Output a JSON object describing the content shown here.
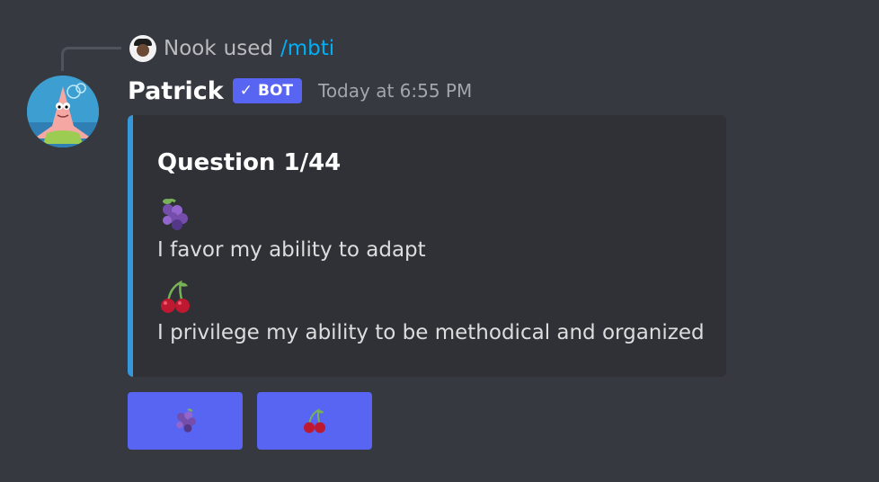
{
  "reply": {
    "user": "Nook",
    "used_text": "used",
    "command": "/mbti"
  },
  "message": {
    "username": "Patrick",
    "badge": "BOT",
    "timestamp": "Today at 6:55 PM"
  },
  "embed": {
    "accent_color": "#3498db",
    "title": "Question 1/44",
    "options": [
      {
        "emoji": "grapes-icon",
        "text": "I favor my ability to adapt"
      },
      {
        "emoji": "cherries-icon",
        "text": "I privilege my ability to be methodical and organized"
      }
    ]
  },
  "buttons": [
    {
      "icon": "grapes-icon"
    },
    {
      "icon": "cherries-icon"
    }
  ],
  "colors": {
    "background": "#36393f",
    "embed_bg": "#2f3136",
    "blurple": "#5865f2",
    "link": "#00aff4"
  }
}
